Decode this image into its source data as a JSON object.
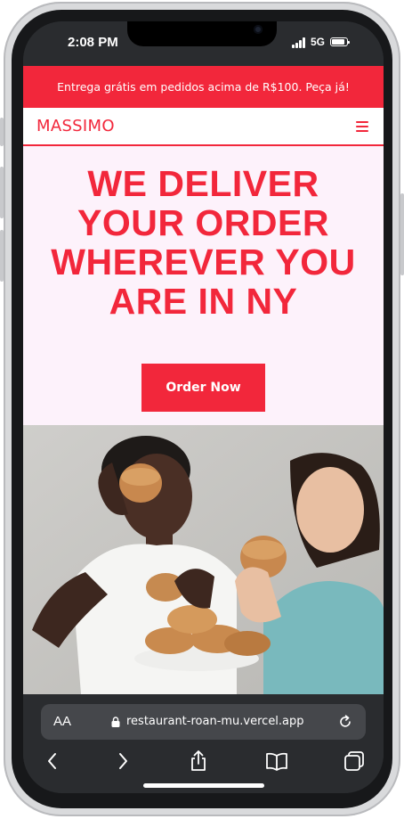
{
  "status": {
    "time": "2:08 PM",
    "network": "5G"
  },
  "promo": {
    "text": "Entrega grátis em pedidos acima de R$100. Peça já!"
  },
  "nav": {
    "brand": "MASSIMO"
  },
  "hero": {
    "title_lines": [
      "WE DELIVER",
      "YOUR ORDER",
      "WHEREVER YOU",
      "ARE IN NY"
    ],
    "cta_label": "Order Now"
  },
  "browser": {
    "reader_label": "AA",
    "url": "restaurant-roan-mu.vercel.app"
  },
  "colors": {
    "accent": "#f2273b",
    "hero_bg": "#fdf2fb",
    "chrome": "#2a2c2f"
  },
  "icons": {
    "menu": "hamburger-icon",
    "lock": "lock-icon",
    "reload": "reload-icon",
    "back": "chevron-left-icon",
    "forward": "chevron-right-icon",
    "share": "share-icon",
    "bookmarks": "book-icon",
    "tabs": "tabs-icon"
  }
}
